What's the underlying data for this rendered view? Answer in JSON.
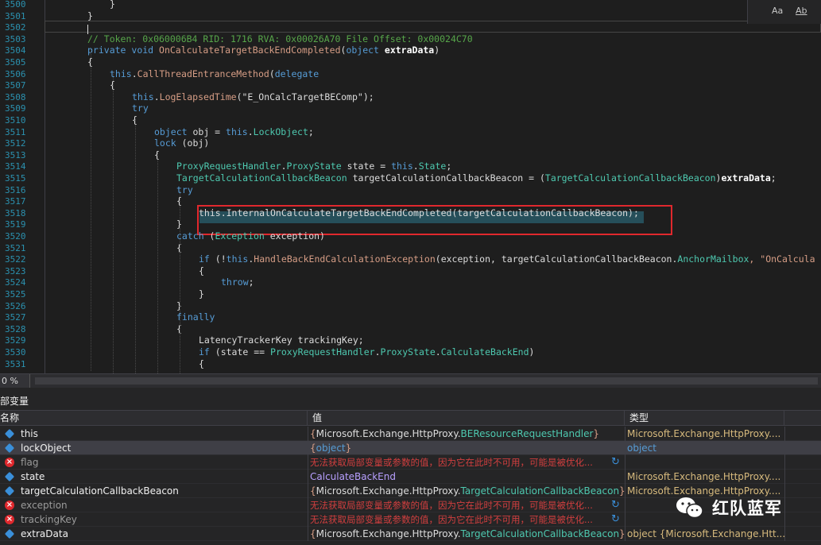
{
  "editor": {
    "line_numbers": [
      "3500",
      "3501",
      "3502",
      "3503",
      "3504",
      "3505",
      "3506",
      "3507",
      "3508",
      "3509",
      "3510",
      "3511",
      "3512",
      "3513",
      "3514",
      "3515",
      "3516",
      "3517",
      "3518",
      "3519",
      "3520",
      "3521",
      "3522",
      "3523",
      "3524",
      "3525",
      "3526",
      "3527",
      "3528",
      "3529",
      "3530",
      "3531"
    ],
    "lines": [
      {
        "indent": 1,
        "spans": [
          {
            "t": "}",
            "c": "pl"
          }
        ]
      },
      {
        "indent": 0,
        "spans": [
          {
            "t": "}",
            "c": "pl"
          }
        ]
      },
      {
        "indent": 0,
        "spans": []
      },
      {
        "indent": 0,
        "spans": [
          {
            "t": "// Token: 0x060006B4 RID: 1716 RVA: 0x00026A70 File Offset: 0x00024C70",
            "c": "cm"
          }
        ]
      },
      {
        "indent": 0,
        "spans": [
          {
            "t": "private ",
            "c": "kw"
          },
          {
            "t": "void ",
            "c": "kw"
          },
          {
            "t": "OnCalculateTargetBackEndCompleted",
            "c": "st"
          },
          {
            "t": "(",
            "c": "pl"
          },
          {
            "t": "object ",
            "c": "kw"
          },
          {
            "t": "extraData",
            "c": "pa"
          },
          {
            "t": ")",
            "c": "pl"
          }
        ]
      },
      {
        "indent": 0,
        "spans": [
          {
            "t": "{",
            "c": "pl"
          }
        ]
      },
      {
        "indent": 1,
        "spans": [
          {
            "t": "this",
            "c": "kw"
          },
          {
            "t": ".",
            "c": "pl"
          },
          {
            "t": "CallThreadEntranceMethod",
            "c": "st"
          },
          {
            "t": "(",
            "c": "pl"
          },
          {
            "t": "delegate",
            "c": "kw"
          }
        ]
      },
      {
        "indent": 1,
        "spans": [
          {
            "t": "{",
            "c": "pl"
          }
        ]
      },
      {
        "indent": 2,
        "spans": [
          {
            "t": "this",
            "c": "kw"
          },
          {
            "t": ".",
            "c": "pl"
          },
          {
            "t": "LogElapsedTime",
            "c": "st"
          },
          {
            "t": "(\"E_OnCalcTargetBEComp\");",
            "c": "pl"
          }
        ]
      },
      {
        "indent": 2,
        "spans": [
          {
            "t": "try",
            "c": "kw"
          }
        ]
      },
      {
        "indent": 2,
        "spans": [
          {
            "t": "{",
            "c": "pl"
          }
        ]
      },
      {
        "indent": 3,
        "spans": [
          {
            "t": "object ",
            "c": "kw"
          },
          {
            "t": "obj = ",
            "c": "pl"
          },
          {
            "t": "this",
            "c": "kw"
          },
          {
            "t": ".",
            "c": "pl"
          },
          {
            "t": "LockObject",
            "c": "ty"
          },
          {
            "t": ";",
            "c": "pl"
          }
        ]
      },
      {
        "indent": 3,
        "spans": [
          {
            "t": "lock ",
            "c": "kw"
          },
          {
            "t": "(obj)",
            "c": "pl"
          }
        ]
      },
      {
        "indent": 3,
        "spans": [
          {
            "t": "{",
            "c": "pl"
          }
        ]
      },
      {
        "indent": 4,
        "spans": [
          {
            "t": "ProxyRequestHandler",
            "c": "ty"
          },
          {
            "t": ".",
            "c": "pl"
          },
          {
            "t": "ProxyState ",
            "c": "ty"
          },
          {
            "t": "state = ",
            "c": "pl"
          },
          {
            "t": "this",
            "c": "kw"
          },
          {
            "t": ".",
            "c": "pl"
          },
          {
            "t": "State",
            "c": "ty"
          },
          {
            "t": ";",
            "c": "pl"
          }
        ]
      },
      {
        "indent": 4,
        "spans": [
          {
            "t": "TargetCalculationCallbackBeacon ",
            "c": "ty"
          },
          {
            "t": "targetCalculationCallbackBeacon = (",
            "c": "pl"
          },
          {
            "t": "TargetCalculationCallbackBeacon",
            "c": "ty"
          },
          {
            "t": ")",
            "c": "pl"
          },
          {
            "t": "extraData",
            "c": "pa"
          },
          {
            "t": ";",
            "c": "pl"
          }
        ]
      },
      {
        "indent": 4,
        "spans": [
          {
            "t": "try",
            "c": "kw"
          }
        ]
      },
      {
        "indent": 4,
        "spans": [
          {
            "t": "{",
            "c": "pl"
          }
        ]
      },
      {
        "indent": 5,
        "spans": [
          {
            "t": "this.InternalOnCalculateTargetBackEndCompleted(targetCalculationCallbackBeacon);",
            "c": "pl"
          }
        ]
      },
      {
        "indent": 4,
        "spans": [
          {
            "t": "}",
            "c": "pl"
          }
        ]
      },
      {
        "indent": 4,
        "spans": [
          {
            "t": "catch ",
            "c": "kw"
          },
          {
            "t": "(",
            "c": "pl"
          },
          {
            "t": "Exception ",
            "c": "ty"
          },
          {
            "t": "exception)",
            "c": "pl"
          }
        ]
      },
      {
        "indent": 4,
        "spans": [
          {
            "t": "{",
            "c": "pl"
          }
        ]
      },
      {
        "indent": 5,
        "spans": [
          {
            "t": "if ",
            "c": "kw"
          },
          {
            "t": "(!",
            "c": "pl"
          },
          {
            "t": "this",
            "c": "kw"
          },
          {
            "t": ".",
            "c": "pl"
          },
          {
            "t": "HandleBackEndCalculationException",
            "c": "st"
          },
          {
            "t": "(exception, targetCalculationCallbackBeacon.",
            "c": "pl"
          },
          {
            "t": "AnchorMailbox",
            "c": "ty"
          },
          {
            "t": ", \"OnCalcula",
            "c": "st"
          }
        ]
      },
      {
        "indent": 5,
        "spans": [
          {
            "t": "{",
            "c": "pl"
          }
        ]
      },
      {
        "indent": 6,
        "spans": [
          {
            "t": "throw",
            "c": "kw"
          },
          {
            "t": ";",
            "c": "pl"
          }
        ]
      },
      {
        "indent": 5,
        "spans": [
          {
            "t": "}",
            "c": "pl"
          }
        ]
      },
      {
        "indent": 4,
        "spans": [
          {
            "t": "}",
            "c": "pl"
          }
        ]
      },
      {
        "indent": 4,
        "spans": [
          {
            "t": "finally",
            "c": "kw"
          }
        ]
      },
      {
        "indent": 4,
        "spans": [
          {
            "t": "{",
            "c": "pl"
          }
        ]
      },
      {
        "indent": 5,
        "spans": [
          {
            "t": "LatencyTrackerKey ",
            "c": "pl"
          },
          {
            "t": "trackingKey;",
            "c": "pl"
          }
        ]
      },
      {
        "indent": 5,
        "spans": [
          {
            "t": "if ",
            "c": "kw"
          },
          {
            "t": "(state == ",
            "c": "pl"
          },
          {
            "t": "ProxyRequestHandler",
            "c": "ty"
          },
          {
            "t": ".",
            "c": "pl"
          },
          {
            "t": "ProxyState",
            "c": "ty"
          },
          {
            "t": ".",
            "c": "pl"
          },
          {
            "t": "CalculateBackEnd",
            "c": "ty"
          },
          {
            "t": ")",
            "c": "pl"
          }
        ]
      },
      {
        "indent": 5,
        "spans": [
          {
            "t": "{",
            "c": "pl"
          }
        ]
      }
    ],
    "find_buttons": [
      "Aa",
      "Ab"
    ]
  },
  "status": {
    "zoom": "0 %"
  },
  "locals": {
    "title": "部变量",
    "headers": {
      "name": "名称",
      "value": "值",
      "type": "类型"
    },
    "rows": [
      {
        "name": "this",
        "status": "ok",
        "name_muted": false,
        "val_style": "obj",
        "val_parts": [
          "{",
          "Microsoft.Exchange.HttpProxy.",
          "BEResourceRequestHandler",
          "}"
        ],
        "type_parts": [
          "Microsoft.Exchange.HttpProxy...."
        ],
        "refresh": false
      },
      {
        "name": "lockObject",
        "status": "ok",
        "name_muted": false,
        "val_style": "obj",
        "val_parts": [
          "{",
          "object",
          "",
          "}"
        ],
        "type_parts": [
          "object"
        ],
        "type_blue": true,
        "refresh": false,
        "selected": true
      },
      {
        "name": "flag",
        "status": "error",
        "name_muted": true,
        "val_style": "err",
        "val_text": "无法获取局部变量或参数的值，因为它在此时不可用，可能是被优化...",
        "type_parts": [
          ""
        ],
        "refresh": true
      },
      {
        "name": "state",
        "status": "ok",
        "name_muted": false,
        "val_style": "enum",
        "val_text": "CalculateBackEnd",
        "type_parts": [
          "Microsoft.Exchange.HttpProxy...."
        ],
        "refresh": false
      },
      {
        "name": "targetCalculationCallbackBeacon",
        "status": "ok",
        "name_muted": false,
        "val_style": "obj",
        "val_parts": [
          "{",
          "Microsoft.Exchange.HttpProxy.",
          "TargetCalculationCallbackBeacon",
          "}"
        ],
        "type_parts": [
          "Microsoft.Exchange.HttpProxy...."
        ],
        "refresh": false
      },
      {
        "name": "exception",
        "status": "error",
        "name_muted": true,
        "val_style": "err",
        "val_text": "无法获取局部变量或参数的值，因为它在此时不可用，可能是被优化...",
        "type_parts": [
          ""
        ],
        "refresh": true
      },
      {
        "name": "trackingKey",
        "status": "error",
        "name_muted": true,
        "val_style": "err",
        "val_text": "无法获取局部变量或参数的值，因为它在此时不可用，可能是被优化...",
        "type_parts": [
          ""
        ],
        "refresh": true
      },
      {
        "name": "extraData",
        "status": "ok",
        "name_muted": false,
        "val_style": "obj",
        "val_parts": [
          "{",
          "Microsoft.Exchange.HttpProxy.",
          "TargetCalculationCallbackBeacon",
          "}"
        ],
        "type_parts": [
          "object {Microsoft.Exchange.Htt..."
        ],
        "type_mixed": true,
        "refresh": false
      }
    ]
  },
  "watermark": {
    "text": "红队蓝军"
  },
  "colors": {
    "highlight_border": "#e0282d",
    "accent": "#3a8fd9"
  }
}
